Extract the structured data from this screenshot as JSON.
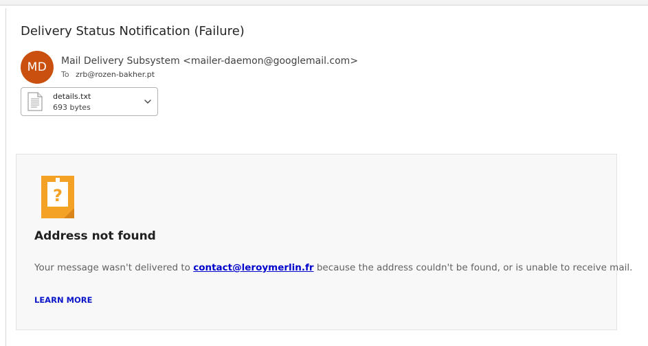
{
  "email": {
    "subject": "Delivery Status Notification (Failure)",
    "sender": {
      "initials": "MD",
      "display": "Mail Delivery Subsystem <mailer-daemon@googlemail.com>",
      "avatar_color": "#ca5010"
    },
    "recipient": {
      "label": "To",
      "address": "zrb@rozen-bakher.pt"
    },
    "attachment": {
      "icon": "text-file-icon",
      "name": "details.txt",
      "size": "693 bytes"
    }
  },
  "bounce_card": {
    "icon": "question-warning-icon",
    "accent_color": "#f4a226",
    "heading": "Address not found",
    "message_prefix": "Your message wasn't delivered to ",
    "failed_address": "contact@leroymerlin.fr",
    "message_suffix": " because the address couldn't be found, or is unable to receive mail.",
    "learn_more": "LEARN MORE",
    "link_color": "#0b16c8"
  }
}
